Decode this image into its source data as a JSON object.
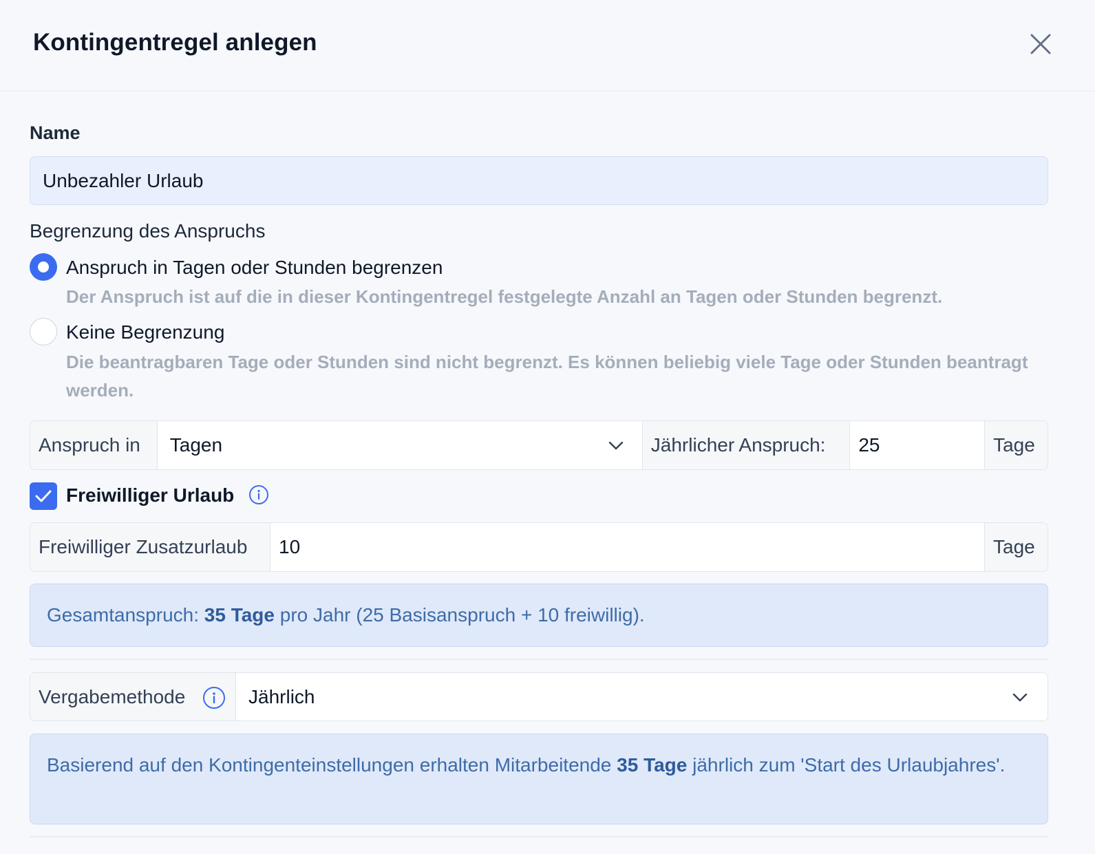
{
  "dialog": {
    "title": "Kontingentregel anlegen"
  },
  "name_field": {
    "label": "Name",
    "value": "Unbezahler Urlaub"
  },
  "limit": {
    "label": "Begrenzung des Anspruchs",
    "options": [
      {
        "title": "Anspruch in Tagen oder Stunden begrenzen",
        "description": "Der Anspruch ist auf die in dieser Kontingentregel festgelegte Anzahl an Tagen oder Stunden begrenzt.",
        "selected": true
      },
      {
        "title": "Keine Begrenzung",
        "description": "Die beantragbaren Tage oder Stunden sind nicht begrenzt. Es können beliebig viele Tage oder Stunden beantragt werden.",
        "selected": false
      }
    ]
  },
  "entitlement": {
    "unit_label": "Anspruch in",
    "unit_value": "Tagen",
    "annual_label": "Jährlicher Anspruch:",
    "annual_value": "25",
    "annual_suffix": "Tage"
  },
  "voluntary": {
    "checked": true,
    "label": "Freiwilliger Urlaub",
    "extra_label": "Freiwilliger Zusatzurlaub",
    "extra_value": "10",
    "extra_suffix": "Tage"
  },
  "total_alert": {
    "prefix": "Gesamtanspruch: ",
    "bold": "35 Tage",
    "suffix": " pro Jahr (25 Basisanspruch + 10 freiwillig)."
  },
  "method": {
    "label": "Vergabemethode",
    "value": "Jährlich"
  },
  "method_alert": {
    "prefix": "Basierend auf den Kontingenteinstellungen erhalten Mitarbeitende ",
    "bold": "35 Tage",
    "suffix": " jährlich zum 'Start des Urlaubjahres'."
  },
  "colors": {
    "accent": "#3b6cf0",
    "alert_bg": "#dfe9f9",
    "alert_text": "#3f6ba8"
  }
}
